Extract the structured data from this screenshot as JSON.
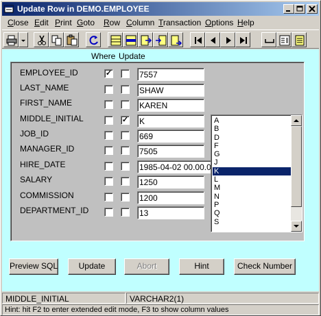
{
  "window": {
    "title": "Update Row in DEMO.EMPLOYEE"
  },
  "menu": [
    "Close",
    "Edit",
    "Print",
    "Goto",
    "Row",
    "Column",
    "Transaction",
    "Options",
    "Help"
  ],
  "toolbar_icons": [
    "print-icon",
    "dropdown-arrow-icon",
    "cut-icon",
    "copy-icon",
    "paste-icon",
    "refresh-icon",
    "row-icon",
    "insert-row-icon",
    "row-arrow-icon",
    "row-indent-icon",
    "row-outdent-icon",
    "first-record-icon",
    "previous-record-icon",
    "next-record-icon",
    "last-record-icon",
    "space-icon",
    "form-icon",
    "notes-icon"
  ],
  "headers": {
    "where": "Where",
    "update": "Update"
  },
  "fields": [
    {
      "name": "EMPLOYEE_ID",
      "where": true,
      "update": false,
      "value": "7557"
    },
    {
      "name": "LAST_NAME",
      "where": false,
      "update": false,
      "value": "SHAW"
    },
    {
      "name": "FIRST_NAME",
      "where": false,
      "update": false,
      "value": "KAREN"
    },
    {
      "name": "MIDDLE_INITIAL",
      "where": false,
      "update": true,
      "value": "K"
    },
    {
      "name": "JOB_ID",
      "where": false,
      "update": false,
      "value": "669"
    },
    {
      "name": "MANAGER_ID",
      "where": false,
      "update": false,
      "value": "7505"
    },
    {
      "name": "HIRE_DATE",
      "where": false,
      "update": false,
      "value": "1985-04-02 00.00.00"
    },
    {
      "name": "SALARY",
      "where": false,
      "update": false,
      "value": "1250"
    },
    {
      "name": "COMMISSION",
      "where": false,
      "update": false,
      "value": "1200"
    },
    {
      "name": "DEPARTMENT_ID",
      "where": false,
      "update": false,
      "value": "13"
    }
  ],
  "list": {
    "items": [
      "A",
      "B",
      "D",
      "F",
      "G",
      "J",
      "K",
      "L",
      "M",
      "N",
      "P",
      "Q",
      "S"
    ],
    "selected": "K"
  },
  "buttons": {
    "preview_sql": "Preview SQL",
    "update": "Update",
    "abort": "Abort",
    "hint": "Hint",
    "check_number": "Check Number"
  },
  "status": {
    "column": "MIDDLE_INITIAL",
    "type": "VARCHAR2(1)",
    "hint": "Hint: hit F2 to enter extended edit mode, F3 to show column values"
  },
  "colors": {
    "titlebar_start": "#0a246a",
    "titlebar_end": "#a6caf0",
    "content_bg": "#c0ffff",
    "selection": "#0a246a"
  }
}
